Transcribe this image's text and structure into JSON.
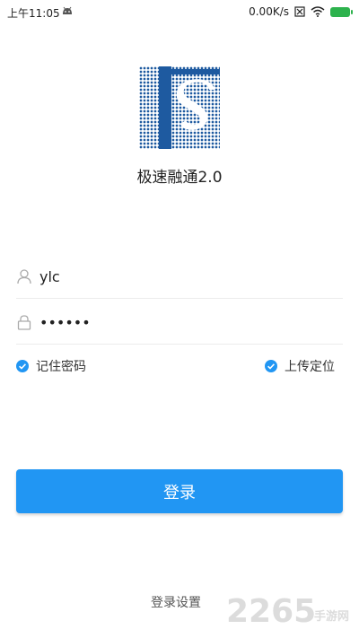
{
  "status_bar": {
    "time": "上午11:05",
    "net_speed": "0.00K/s",
    "icons": [
      "android-icon",
      "sim-blocked-icon",
      "wifi-icon",
      "battery-charging-icon"
    ]
  },
  "app": {
    "title": "极速融通2.0",
    "logo_letter": "S",
    "logo_color": "#1e5aa0"
  },
  "form": {
    "username": {
      "value": "ylc",
      "icon": "user-icon"
    },
    "password": {
      "value": "••••••",
      "icon": "lock-icon"
    },
    "remember_password": {
      "label": "记住密码",
      "checked": true
    },
    "upload_location": {
      "label": "上传定位",
      "checked": true
    },
    "login_button": "登录",
    "login_settings": "登录设置"
  },
  "watermark": {
    "number": "2265",
    "text": "手游网"
  },
  "colors": {
    "accent": "#2196f3",
    "check": "#2196f3",
    "battery": "#2db24d"
  }
}
